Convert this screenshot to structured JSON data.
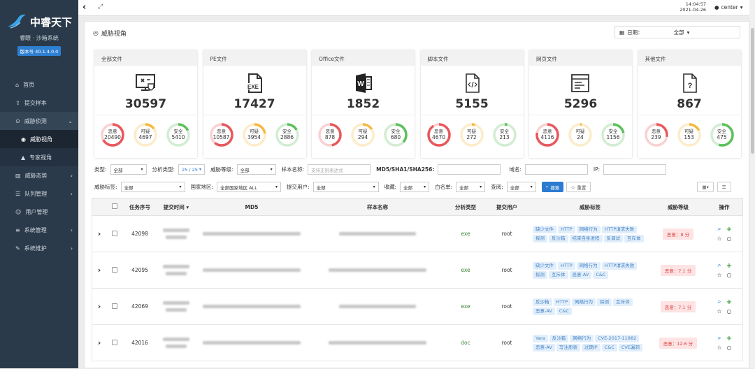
{
  "app": {
    "title": "中睿天下",
    "subtitle": "睿眼 · 沙箱系统",
    "version": "版本号 40.1.4.0.0"
  },
  "nav": [
    {
      "label": "首页",
      "icon": "home-icon",
      "chev": ""
    },
    {
      "label": "提交样本",
      "icon": "upload-icon",
      "chev": ""
    },
    {
      "label": "威胁侦测",
      "icon": "radar-icon",
      "chev": "›"
    },
    {
      "label": "威胁视角",
      "icon": "target-icon",
      "chev": ""
    },
    {
      "label": "专家视角",
      "icon": "graduation-icon",
      "chev": ""
    },
    {
      "label": "威胁态势",
      "icon": "chart-icon",
      "chev": "›"
    },
    {
      "label": "队列管理",
      "icon": "list-icon",
      "chev": "›"
    },
    {
      "label": "用户管理",
      "icon": "user-icon",
      "chev": ""
    },
    {
      "label": "系统管理",
      "icon": "sliders-icon",
      "chev": "›"
    },
    {
      "label": "系统维护",
      "icon": "wrench-icon",
      "chev": "›"
    }
  ],
  "topbar": {
    "time": "14:04:57",
    "date": "2021-04-26",
    "user": "center"
  },
  "page": {
    "title": "威胁视角",
    "date_label": "日期：",
    "date_value": "全部"
  },
  "cards": [
    {
      "label": "全部文件",
      "total": "30597",
      "mal": "20490",
      "sus": "4697",
      "safe": "5410",
      "icon": "monitor-icon",
      "mal_frac": 0.67,
      "sus_frac": 0.15,
      "safe_frac": 0.18
    },
    {
      "label": "PE文件",
      "total": "17427",
      "mal": "10587",
      "sus": "3954",
      "safe": "2886",
      "icon": "exe-file-icon",
      "mal_frac": 0.61,
      "sus_frac": 0.23,
      "safe_frac": 0.17
    },
    {
      "label": "Office文件",
      "total": "1852",
      "mal": "878",
      "sus": "294",
      "safe": "680",
      "icon": "word-icon",
      "mal_frac": 0.47,
      "sus_frac": 0.16,
      "safe_frac": 0.37
    },
    {
      "label": "脚本文件",
      "total": "5155",
      "mal": "4670",
      "sus": "272",
      "safe": "213",
      "icon": "code-file-icon",
      "mal_frac": 0.91,
      "sus_frac": 0.05,
      "safe_frac": 0.04
    },
    {
      "label": "网页文件",
      "total": "5296",
      "mal": "4116",
      "sus": "24",
      "safe": "1156",
      "icon": "webpage-icon",
      "mal_frac": 0.78,
      "sus_frac": 0.01,
      "safe_frac": 0.22
    },
    {
      "label": "其他文件",
      "total": "867",
      "mal": "239",
      "sus": "153",
      "safe": "475",
      "icon": "unknown-file-icon",
      "mal_frac": 0.28,
      "sus_frac": 0.18,
      "safe_frac": 0.55
    }
  ],
  "ring_labels": {
    "mal": "恶意",
    "sus": "可疑",
    "safe": "安全"
  },
  "colors": {
    "mal": "#e8585c",
    "sus": "#f5b942",
    "safe": "#5cc05c",
    "accent": "#2b7bd0"
  },
  "filters": {
    "type_label": "类型:",
    "type_value": "全部",
    "atype_label": "分析类型:",
    "atype_value": "25 / 25",
    "level_label": "威胁等级:",
    "level_value": "全部",
    "name_label": "样本名称:",
    "name_placeholder": "支持正则表达式",
    "md5_label": "MD5/SHA1/SHA256:",
    "domain_label": "域名:",
    "ip_label": "IP:",
    "tag_label": "威胁标签:",
    "tag_value": "全部",
    "region_label": "国家地区:",
    "region_value": "全部国家地区 ALL",
    "user_label": "提交用户:",
    "user_value": "全部",
    "fav_label": "收藏:",
    "fav_value": "全部",
    "white_label": "白名单:",
    "white_value": "全部",
    "read_label": "查阅:",
    "read_value": "全部",
    "search": "搜索",
    "reset": "重置"
  },
  "table": {
    "headers": {
      "id": "任务序号",
      "time": "提交时间",
      "md5": "MD5",
      "name": "样本名称",
      "atype": "分析类型",
      "user": "提交用户",
      "tags": "威胁标签",
      "level": "威胁等级",
      "ops": "操作"
    },
    "rows": [
      {
        "id": "42098",
        "atype": "exe",
        "user": "root",
        "tags": [
          "缺少文件",
          "HTTP",
          "网络行为",
          "HTTP请求失败",
          "探测",
          "反沙箱",
          "结束自身进程",
          "反调试",
          "互斥体"
        ],
        "level": "恶意：8 分"
      },
      {
        "id": "42095",
        "atype": "exe",
        "user": "root",
        "tags": [
          "缺少文件",
          "HTTP",
          "网络行为",
          "HTTP请求失败",
          "探测",
          "互斥体",
          "恶意-AV",
          "C&C"
        ],
        "level": "恶意：7.1 分"
      },
      {
        "id": "42069",
        "atype": "exe",
        "user": "root",
        "tags": [
          "反沙箱",
          "HTTP",
          "网络行为",
          "探测",
          "互斥体",
          "恶意-AV",
          "C&C"
        ],
        "level": "恶意：7.1 分"
      },
      {
        "id": "42016",
        "atype": "doc",
        "user": "root",
        "tags": [
          "Yara",
          "反沙箱",
          "网络行为",
          "CVE-2017-11882",
          "恶意-AV",
          "写注册表",
          "过期IP",
          "C&C",
          "CVE漏洞"
        ],
        "level": "恶意：12.6 分"
      }
    ]
  }
}
